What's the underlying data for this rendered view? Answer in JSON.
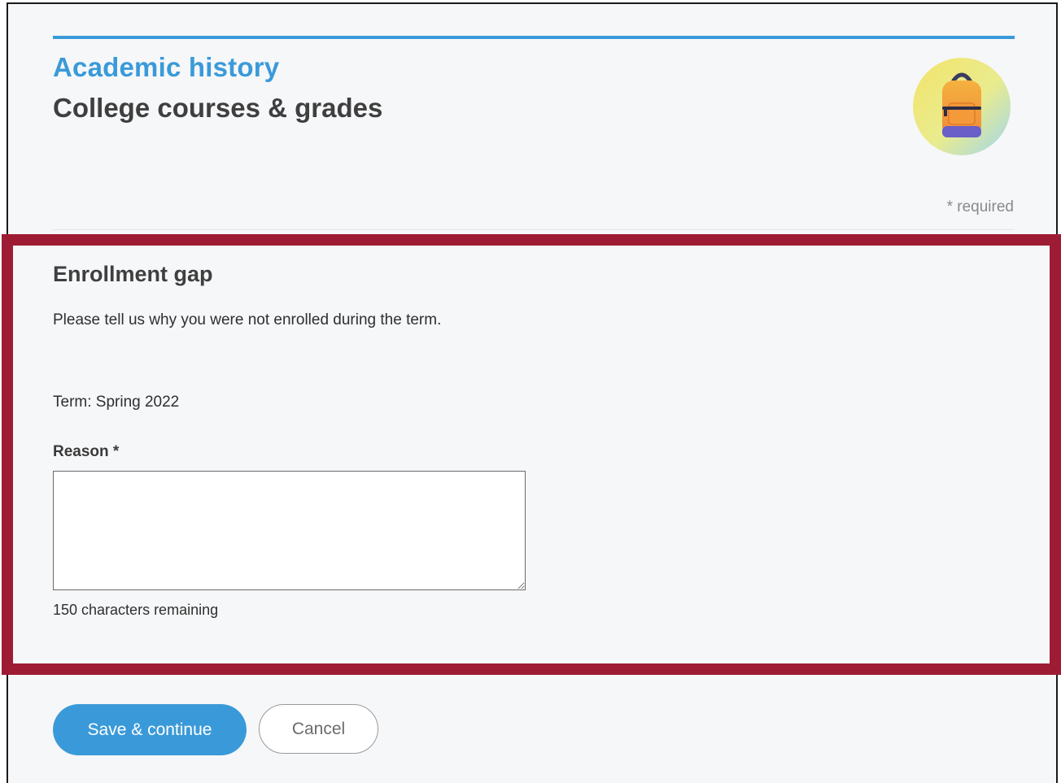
{
  "header": {
    "section_label": "Academic history",
    "page_title": "College courses & grades",
    "required_note": "* required",
    "badge_icon": "backpack-icon"
  },
  "enrollment_gap": {
    "heading": "Enrollment gap",
    "intro": "Please tell us why you were not enrolled during the term.",
    "term_line": "Term: Spring 2022",
    "reason_label": "Reason *",
    "reason_value": "",
    "chars_remaining": "150 characters remaining"
  },
  "actions": {
    "save_label": "Save & continue",
    "cancel_label": "Cancel"
  },
  "colors": {
    "accent": "#3a9ad9",
    "highlight": "#9e1c33",
    "background": "#f6f7f9"
  }
}
